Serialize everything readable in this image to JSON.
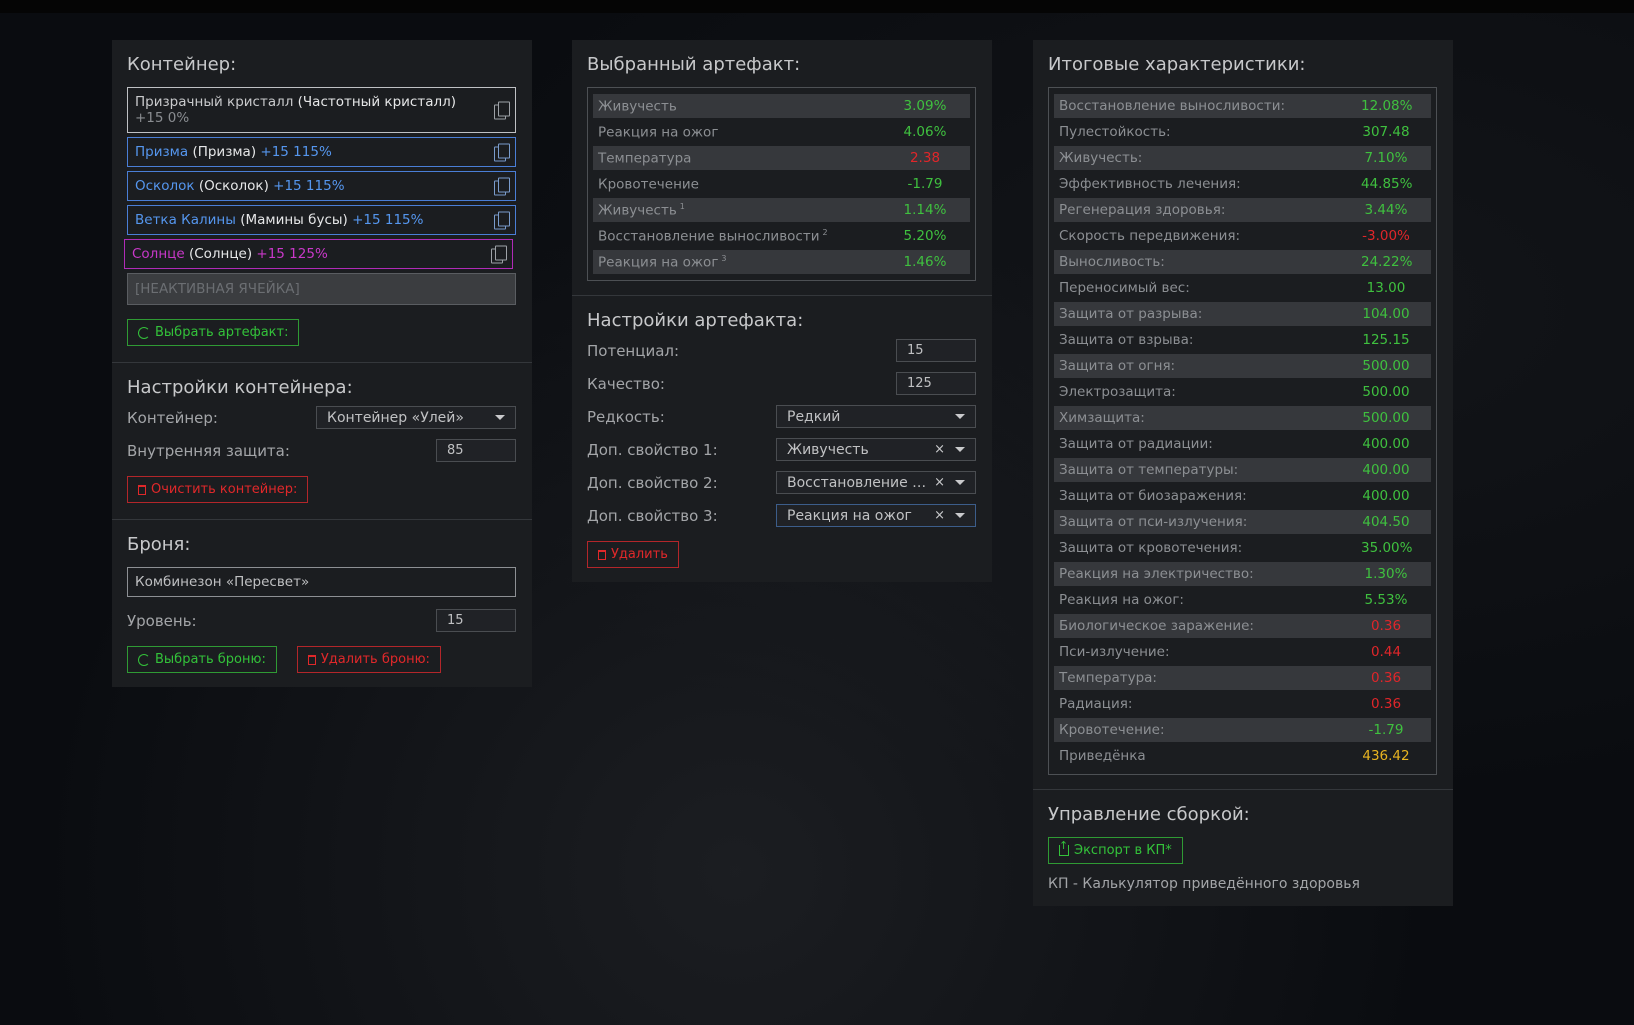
{
  "container_panel": {
    "title": "Контейнер:",
    "slots": [
      {
        "name": "Призрачный кристалл",
        "original": "(Частотный кристалл)",
        "level": "+15 0%",
        "style": "grey"
      },
      {
        "name": "Призма",
        "original": "(Призма)",
        "level": "+15 115%",
        "style": "blue"
      },
      {
        "name": "Осколок",
        "original": "(Осколок)",
        "level": "+15 115%",
        "style": "blue"
      },
      {
        "name": "Ветка Калины",
        "original": "(Мамины бусы)",
        "level": "+15 115%",
        "style": "blue"
      },
      {
        "name": "Солнце",
        "original": "(Солнце)",
        "level": "+15 125%",
        "style": "magenta"
      }
    ],
    "inactive_slot": "[НЕАКТИВНАЯ ЯЧЕЙКА]",
    "select_artifact_button": "Выбрать артефакт:"
  },
  "container_settings": {
    "title": "Настройки контейнера:",
    "container_label": "Контейнер:",
    "container_value": "Контейнер «Улей»",
    "protection_label": "Внутренняя защита:",
    "protection_value": "85",
    "clear_button": "Очистить контейнер:"
  },
  "armor": {
    "title": "Броня:",
    "value": "Комбинезон «Пересвет»",
    "level_label": "Уровень:",
    "level_value": "15",
    "select_button": "Выбрать броню:",
    "delete_button": "Удалить броню:"
  },
  "selected_artifact": {
    "title": "Выбранный артефакт:",
    "stats": [
      {
        "label": "Живучесть",
        "sup": "",
        "value": "3.09%",
        "tone": "pos"
      },
      {
        "label": "Реакция на ожог",
        "sup": "",
        "value": "4.06%",
        "tone": "pos"
      },
      {
        "label": "Температура",
        "sup": "",
        "value": "2.38",
        "tone": "neg"
      },
      {
        "label": "Кровотечение",
        "sup": "",
        "value": "-1.79",
        "tone": "pos"
      },
      {
        "label": "Живучесть",
        "sup": "1",
        "value": "1.14%",
        "tone": "pos"
      },
      {
        "label": "Восстановление выносливости",
        "sup": "2",
        "value": "5.20%",
        "tone": "pos"
      },
      {
        "label": "Реакция на ожог",
        "sup": "3",
        "value": "1.46%",
        "tone": "pos"
      }
    ]
  },
  "artifact_settings": {
    "title": "Настройки артефакта:",
    "potential_label": "Потенциал:",
    "potential_value": "15",
    "quality_label": "Качество:",
    "quality_value": "125",
    "rarity_label": "Редкость:",
    "rarity_value": "Редкий",
    "prop1_label": "Доп. свойство 1:",
    "prop1_value": "Живучесть",
    "prop2_label": "Доп. свойство 2:",
    "prop2_value": "Восстановление выносливости",
    "prop3_label": "Доп. свойство 3:",
    "prop3_value": "Реакция на ожог",
    "clear_x": "×",
    "delete_button": "Удалить"
  },
  "totals": {
    "title": "Итоговые характеристики:",
    "stats": [
      {
        "label": "Восстановление выносливости:",
        "value": "12.08%",
        "tone": "pos"
      },
      {
        "label": "Пулестойкость:",
        "value": "307.48",
        "tone": "pos"
      },
      {
        "label": "Живучесть:",
        "value": "7.10%",
        "tone": "pos"
      },
      {
        "label": "Эффективность лечения:",
        "value": "44.85%",
        "tone": "pos"
      },
      {
        "label": "Регенерация здоровья:",
        "value": "3.44%",
        "tone": "pos"
      },
      {
        "label": "Скорость передвижения:",
        "value": "-3.00%",
        "tone": "neg"
      },
      {
        "label": "Выносливость:",
        "value": "24.22%",
        "tone": "pos"
      },
      {
        "label": "Переносимый вес:",
        "value": "13.00",
        "tone": "pos"
      },
      {
        "label": "Защита от разрыва:",
        "value": "104.00",
        "tone": "pos"
      },
      {
        "label": "Защита от взрыва:",
        "value": "125.15",
        "tone": "pos"
      },
      {
        "label": "Защита от огня:",
        "value": "500.00",
        "tone": "pos"
      },
      {
        "label": "Электрозащита:",
        "value": "500.00",
        "tone": "pos"
      },
      {
        "label": "Химзащита:",
        "value": "500.00",
        "tone": "pos"
      },
      {
        "label": "Защита от радиации:",
        "value": "400.00",
        "tone": "pos"
      },
      {
        "label": "Защита от температуры:",
        "value": "400.00",
        "tone": "pos"
      },
      {
        "label": "Защита от биозаражения:",
        "value": "400.00",
        "tone": "pos"
      },
      {
        "label": "Защита от пси-излучения:",
        "value": "404.50",
        "tone": "pos"
      },
      {
        "label": "Защита от кровотечения:",
        "value": "35.00%",
        "tone": "pos"
      },
      {
        "label": "Реакция на электричество:",
        "value": "1.30%",
        "tone": "pos"
      },
      {
        "label": "Реакция на ожог:",
        "value": "5.53%",
        "tone": "pos"
      },
      {
        "label": "Биологическое заражение:",
        "value": "0.36",
        "tone": "neg"
      },
      {
        "label": "Пси-излучение:",
        "value": "0.44",
        "tone": "neg"
      },
      {
        "label": "Температура:",
        "value": "0.36",
        "tone": "neg"
      },
      {
        "label": "Радиация:",
        "value": "0.36",
        "tone": "neg"
      },
      {
        "label": "Кровотечение:",
        "value": "-1.79",
        "tone": "pos"
      },
      {
        "label": "Приведёнка",
        "value": "436.42",
        "tone": "gold"
      }
    ]
  },
  "build": {
    "title": "Управление сборкой:",
    "export_button": "Экспорт в КП*",
    "footnote": "КП - Калькулятор приведённого здоровья"
  }
}
